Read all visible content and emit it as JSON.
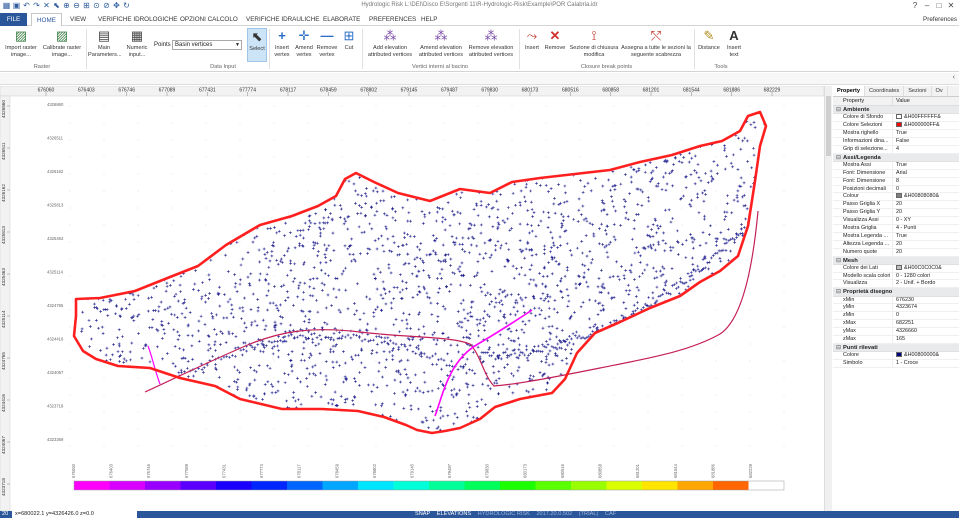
{
  "window": {
    "title": "Hydrologic Risk  L:\\DEI\\Disco E\\Sorgenti 11\\R-Hydrologic-Risk\\Example\\POR Calabria.idr",
    "quick_access": [
      "app-icon",
      "save-icon",
      "undo-icon",
      "redo-icon",
      "close-icon",
      "select-icon",
      "zoom-in-icon",
      "zoom-out-icon",
      "zoom-window-icon",
      "zoom-extent-icon",
      "zoom-previous-icon",
      "pan-icon",
      "refresh-icon"
    ]
  },
  "menu": {
    "file": "FILE",
    "tabs": [
      "HOME",
      "VIEW",
      "VERIFICHE IDROLOGICHE",
      "OPZIONI CALCOLO",
      "VERIFICHE IDRAULICHE",
      "ELABORATE",
      "PREFERENCES",
      "HELP"
    ],
    "active": "HOME",
    "preferences": "Preferences"
  },
  "ribbon": {
    "raster": {
      "import": "Import raster image...",
      "calibrate": "Calibrate raster image...",
      "group": "Raster"
    },
    "data_input": {
      "main": "Main Parameters...",
      "numeric": "Numeric input...",
      "points_label": "Points",
      "points_value": "Basin vertices",
      "group": "Data Input"
    },
    "edit": {
      "select": "Select",
      "insert": "Insert vertex",
      "amend": "Amend vertex",
      "remove": "Remove vertex",
      "cut": "Cut"
    },
    "vertici": {
      "add": "Add elevation attributed vertices",
      "amend": "Amend elevation attributed vertices",
      "remove": "Remove elevation attributed vertices",
      "group": "Vertici interni al bacino"
    },
    "closure": {
      "insert": "Insert",
      "remove": "Remove",
      "sezione": "Sezione di chiusura modifica",
      "assegna": "Assegna a tutte le sezioni la seguente scabrezza",
      "group": "Closure break points"
    },
    "tools": {
      "distance": "Distance",
      "insert_text": "Insert text",
      "group": "Tools"
    }
  },
  "map": {
    "x_ticks": [
      "676060",
      "676403",
      "676746",
      "677089",
      "677431",
      "677774",
      "678117",
      "678459",
      "678802",
      "679145",
      "679487",
      "679830",
      "680173",
      "680516",
      "680858",
      "681201",
      "681544",
      "681886",
      "682229"
    ],
    "y_ticks": [
      "4326860",
      "4326511",
      "4326162",
      "4325813",
      "4325463",
      "4325114",
      "4324765",
      "4324416",
      "4324067",
      "4323718",
      "4323369"
    ],
    "y_left_ticks": [
      "4326860",
      "4326511",
      "4326162",
      "4325813",
      "4325463",
      "4325114",
      "4324765",
      "4324416",
      "4324067",
      "4323718"
    ],
    "colorbar": [
      "#ff00ff",
      "#d800ff",
      "#9a00ff",
      "#5b00ff",
      "#1a00ff",
      "#0026ff",
      "#0066ff",
      "#00a6ff",
      "#00e5ff",
      "#00ffd9",
      "#00ff99",
      "#00ff5a",
      "#1bff00",
      "#5aff00",
      "#99ff00",
      "#d9ff00",
      "#ffe500",
      "#ffa600",
      "#ff6600",
      "#ffffff"
    ],
    "colors": {
      "boundary": "#ff1f1f",
      "points": "#1e1e8c",
      "river": "#c42056",
      "channel": "#ff00ff"
    }
  },
  "panel": {
    "tabs": [
      "Property",
      "Coordinates",
      "Sezioni",
      "Ov"
    ],
    "header": {
      "property": "Property",
      "value": "Value"
    },
    "sections": [
      {
        "title": "Ambiente",
        "rows": [
          {
            "k": "Colore di Sfondo",
            "v": "&H00FFFFFF&",
            "sw": "#ffffff"
          },
          {
            "k": "Colore Selezioni",
            "v": "&H000000FF&",
            "sw": "#ff0000"
          },
          {
            "k": "Mostra righello",
            "v": "True"
          },
          {
            "k": "Informazioni dina...",
            "v": "False"
          },
          {
            "k": "Grip di selezione...",
            "v": "4"
          }
        ]
      },
      {
        "title": "Assi/Legenda",
        "rows": [
          {
            "k": "Mostra Assi",
            "v": "True"
          },
          {
            "k": "Font: Dimensione",
            "v": "Arial"
          },
          {
            "k": "Font: Dimensione",
            "v": "8"
          },
          {
            "k": "Posizioni decimali",
            "v": "0"
          },
          {
            "k": "Colour",
            "v": "&H00808080&",
            "sw": "#808080"
          },
          {
            "k": "Passo Griglia X",
            "v": "20"
          },
          {
            "k": "Passo Griglia Y",
            "v": "20"
          },
          {
            "k": "Visualizza Assi",
            "v": "0 - XY"
          },
          {
            "k": "Mostra Griglia",
            "v": "4 - Punti"
          },
          {
            "k": "Mostra Legenda ...",
            "v": "True"
          },
          {
            "k": "Altezza Legenda ...",
            "v": "20"
          },
          {
            "k": "Numero quote",
            "v": "20"
          }
        ]
      },
      {
        "title": "Mesh",
        "rows": [
          {
            "k": "Colore dei Lati",
            "v": "&H00C0C0C0&",
            "sw": "#c0c0c0"
          },
          {
            "k": "Modello scala colori",
            "v": "0 - 1280 colori"
          },
          {
            "k": "Visualizza",
            "v": "2 - Unif. + Bordo"
          }
        ]
      },
      {
        "title": "Proprietà disegno",
        "rows": [
          {
            "k": "xMin",
            "v": "676230"
          },
          {
            "k": "yMin",
            "v": "4323674"
          },
          {
            "k": "zMin",
            "v": "0"
          },
          {
            "k": "xMax",
            "v": "682251"
          },
          {
            "k": "yMax",
            "v": "4326660"
          },
          {
            "k": "zMax",
            "v": "165"
          }
        ]
      },
      {
        "title": "Punti rilevati",
        "rows": [
          {
            "k": "Colore",
            "v": "&H00800000&",
            "sw": "#000080"
          },
          {
            "k": "Simbolo",
            "v": "1 - Croce"
          }
        ]
      }
    ]
  },
  "status": {
    "left": "20",
    "coords": "x=680022.1 y=4326426.0 z=0.0",
    "items": [
      "SNAP",
      "ELEVATIONS"
    ],
    "dim_items": [
      "HYDROLOGIC RISK",
      "2017.20.0.502",
      "(TRIAL)",
      "CAF"
    ]
  }
}
